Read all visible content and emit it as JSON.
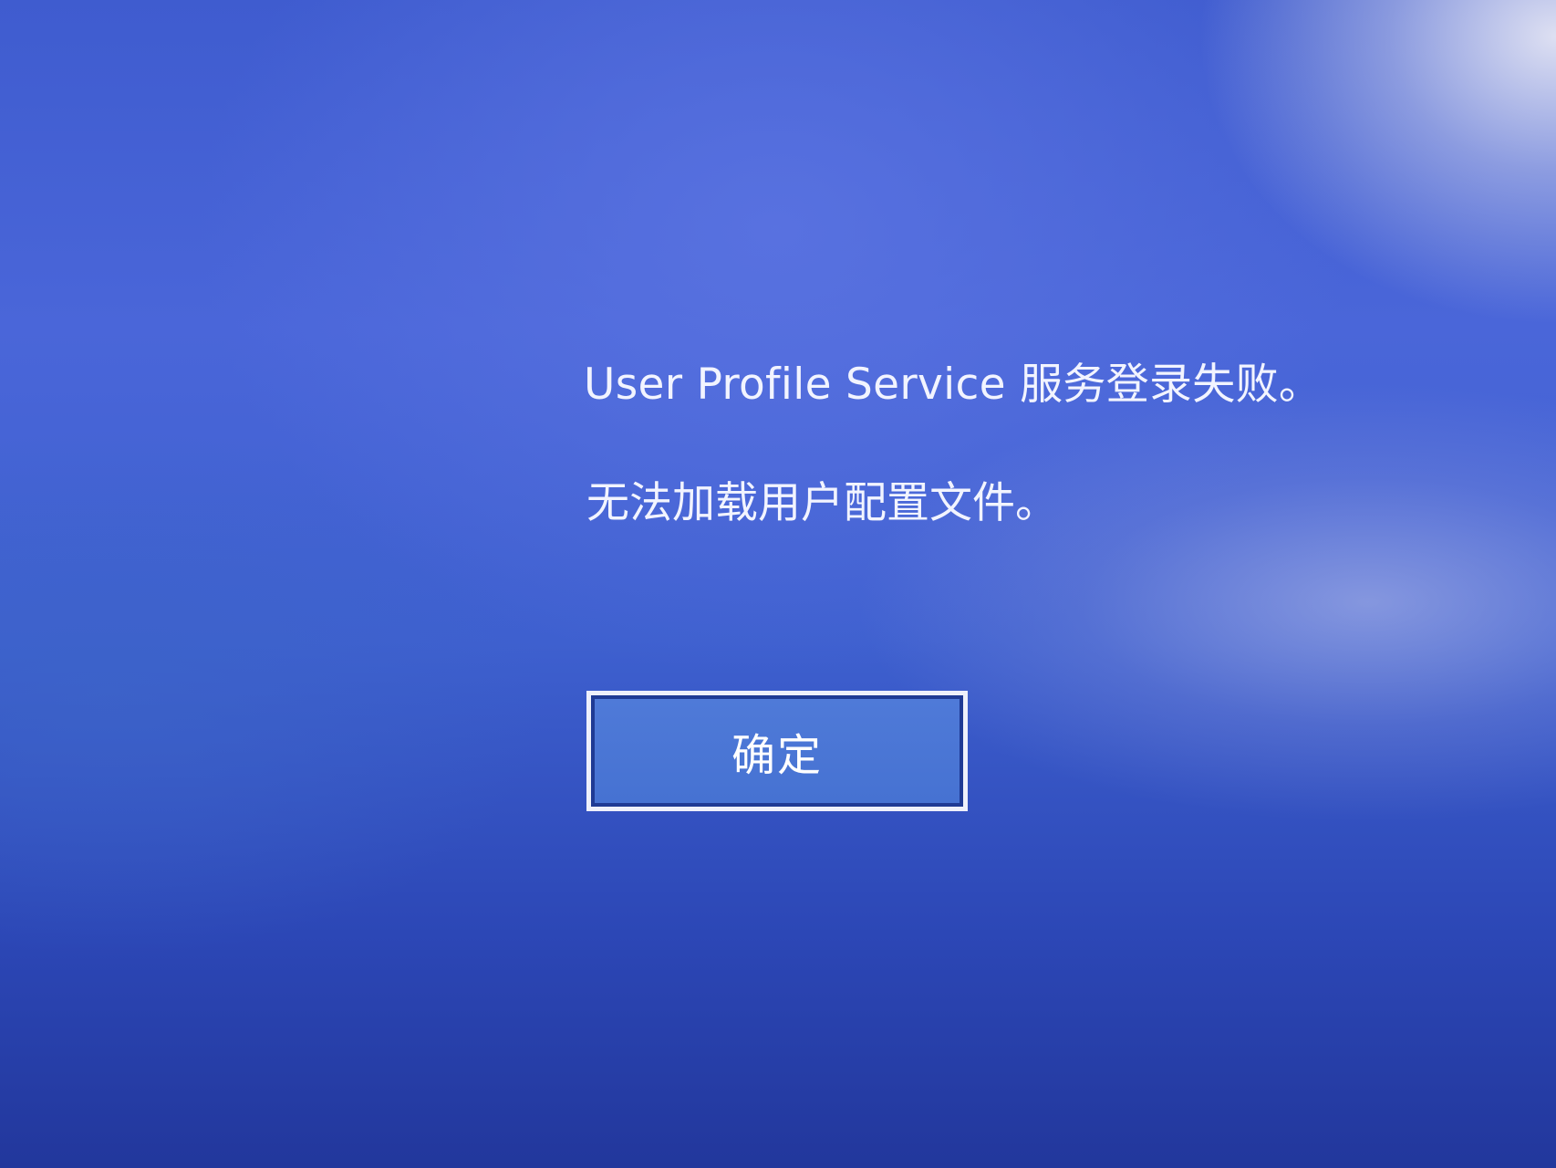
{
  "dialog": {
    "message_title": "User Profile Service 服务登录失败。",
    "message_detail": "无法加载用户配置文件。",
    "ok_button_label": "确定"
  },
  "colors": {
    "background": "#3f5ccf",
    "text": "#f2f4ff",
    "button_fill": "#4a76d5",
    "button_border": "#eef0fb"
  }
}
